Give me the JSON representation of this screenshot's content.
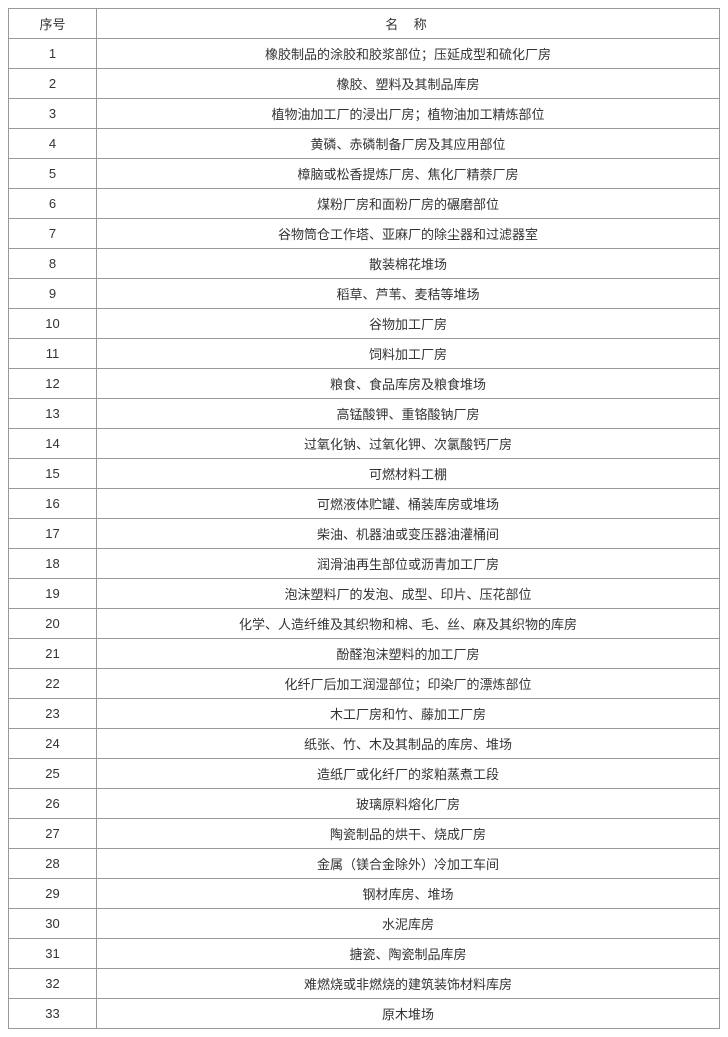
{
  "table": {
    "headers": {
      "seq": "序号",
      "name": "名称"
    },
    "rows": [
      {
        "seq": "1",
        "name": "橡胶制品的涂胶和胶浆部位；压延成型和硫化厂房"
      },
      {
        "seq": "2",
        "name": "橡胶、塑料及其制品库房"
      },
      {
        "seq": "3",
        "name": "植物油加工厂的浸出厂房；植物油加工精炼部位"
      },
      {
        "seq": "4",
        "name": "黄磷、赤磷制备厂房及其应用部位"
      },
      {
        "seq": "5",
        "name": "樟脑或松香提炼厂房、焦化厂精萘厂房"
      },
      {
        "seq": "6",
        "name": "煤粉厂房和面粉厂房的碾磨部位"
      },
      {
        "seq": "7",
        "name": "谷物筒仓工作塔、亚麻厂的除尘器和过滤器室"
      },
      {
        "seq": "8",
        "name": "散装棉花堆场"
      },
      {
        "seq": "9",
        "name": "稻草、芦苇、麦秸等堆场"
      },
      {
        "seq": "10",
        "name": "谷物加工厂房"
      },
      {
        "seq": "11",
        "name": "饲料加工厂房"
      },
      {
        "seq": "12",
        "name": "粮食、食品库房及粮食堆场"
      },
      {
        "seq": "13",
        "name": "高锰酸钾、重铬酸钠厂房"
      },
      {
        "seq": "14",
        "name": "过氧化钠、过氧化钾、次氯酸钙厂房"
      },
      {
        "seq": "15",
        "name": "可燃材料工棚"
      },
      {
        "seq": "16",
        "name": "可燃液体贮罐、桶装库房或堆场"
      },
      {
        "seq": "17",
        "name": "柴油、机器油或变压器油灌桶间"
      },
      {
        "seq": "18",
        "name": "润滑油再生部位或沥青加工厂房"
      },
      {
        "seq": "19",
        "name": "泡沫塑料厂的发泡、成型、印片、压花部位"
      },
      {
        "seq": "20",
        "name": "化学、人造纤维及其织物和棉、毛、丝、麻及其织物的库房"
      },
      {
        "seq": "21",
        "name": "酚醛泡沫塑料的加工厂房"
      },
      {
        "seq": "22",
        "name": "化纤厂后加工润湿部位；印染厂的漂炼部位"
      },
      {
        "seq": "23",
        "name": "木工厂房和竹、藤加工厂房"
      },
      {
        "seq": "24",
        "name": "纸张、竹、木及其制品的库房、堆场"
      },
      {
        "seq": "25",
        "name": "造纸厂或化纤厂的浆粕蒸煮工段"
      },
      {
        "seq": "26",
        "name": "玻璃原料熔化厂房"
      },
      {
        "seq": "27",
        "name": "陶瓷制品的烘干、烧成厂房"
      },
      {
        "seq": "28",
        "name": "金属（镁合金除外）冷加工车间"
      },
      {
        "seq": "29",
        "name": "钢材库房、堆场"
      },
      {
        "seq": "30",
        "name": "水泥库房"
      },
      {
        "seq": "31",
        "name": "搪瓷、陶瓷制品库房"
      },
      {
        "seq": "32",
        "name": "难燃烧或非燃烧的建筑装饰材料库房"
      },
      {
        "seq": "33",
        "name": "原木堆场"
      }
    ]
  }
}
